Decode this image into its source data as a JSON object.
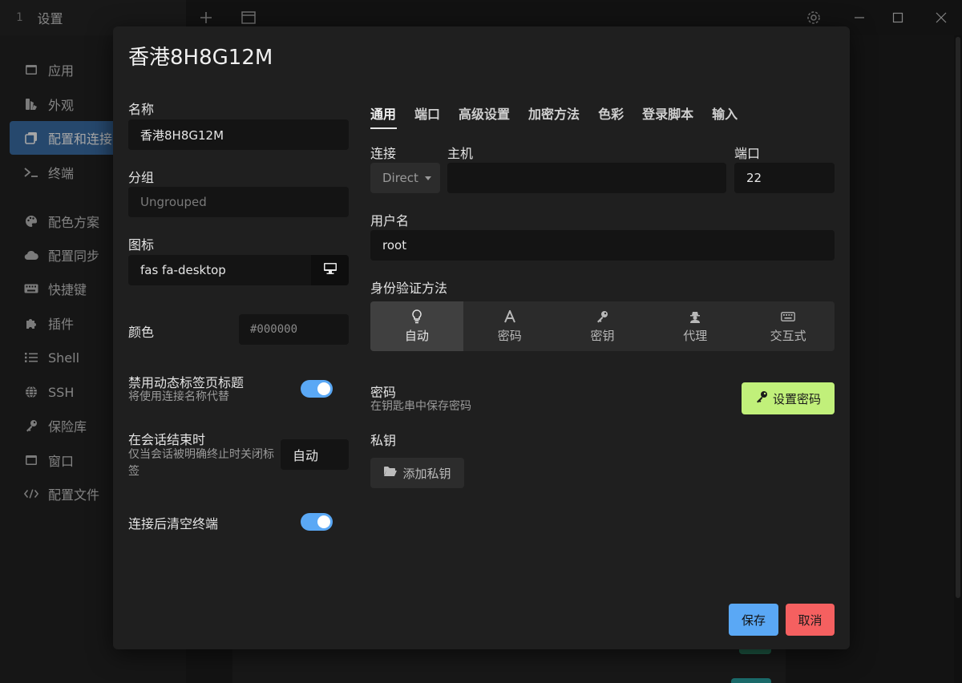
{
  "window": {
    "tab_number": "1",
    "tab_title": "设置"
  },
  "sidebar": {
    "items": [
      {
        "label": "应用",
        "icon": "window-icon"
      },
      {
        "label": "外观",
        "icon": "paint-icon"
      },
      {
        "label": "配置和连接",
        "icon": "copy-icon",
        "active": true
      },
      {
        "label": "终端",
        "icon": "terminal-icon"
      },
      {
        "label": "配色方案",
        "icon": "palette-icon"
      },
      {
        "label": "配置同步",
        "icon": "cloud-icon"
      },
      {
        "label": "快捷键",
        "icon": "keyboard-icon"
      },
      {
        "label": "插件",
        "icon": "puzzle-icon"
      },
      {
        "label": "Shell",
        "icon": "list-icon"
      },
      {
        "label": "SSH",
        "icon": "globe-icon"
      },
      {
        "label": "保险库",
        "icon": "key-icon"
      },
      {
        "label": "窗口",
        "icon": "window-icon"
      },
      {
        "label": "配置文件",
        "icon": "code-icon"
      }
    ]
  },
  "modal": {
    "title": "香港8H8G12M",
    "left": {
      "name_label": "名称",
      "name_value": "香港8H8G12M",
      "group_label": "分组",
      "group_placeholder": "Ungrouped",
      "icon_label": "图标",
      "icon_value": "fas fa-desktop",
      "color_label": "颜色",
      "color_placeholder": "#000000",
      "dynamic_title_label": "禁用动态标签页标题",
      "dynamic_title_sub": "将使用连接名称代替",
      "dynamic_title_on": true,
      "session_end_label": "在会话结束时",
      "session_end_sub": "仅当会话被明确终止时关闭标签",
      "session_end_value": "自动",
      "clear_label": "连接后清空终端",
      "clear_on": true
    },
    "tabs": [
      "通用",
      "端口",
      "高级设置",
      "加密方法",
      "色彩",
      "登录脚本",
      "输入"
    ],
    "general": {
      "connection_label": "连接",
      "connection_value": "Direct",
      "host_label": "主机",
      "host_value": "",
      "port_label": "端口",
      "port_value": "22",
      "username_label": "用户名",
      "username_value": "root",
      "auth_label": "身份验证方法",
      "auth_methods": [
        "自动",
        "密码",
        "密钥",
        "代理",
        "交互式"
      ],
      "password_label": "密码",
      "password_sub": "在钥匙串中保存密码",
      "set_password": "设置密码",
      "private_key_label": "私钥",
      "add_private_key": "添加私钥"
    },
    "save": "保存",
    "cancel": "取消"
  },
  "colors": {
    "accent_blue": "#5aa8f5",
    "green": "#c1f07a",
    "red": "#f56060",
    "sidebar_active": "#3b6fa8"
  }
}
